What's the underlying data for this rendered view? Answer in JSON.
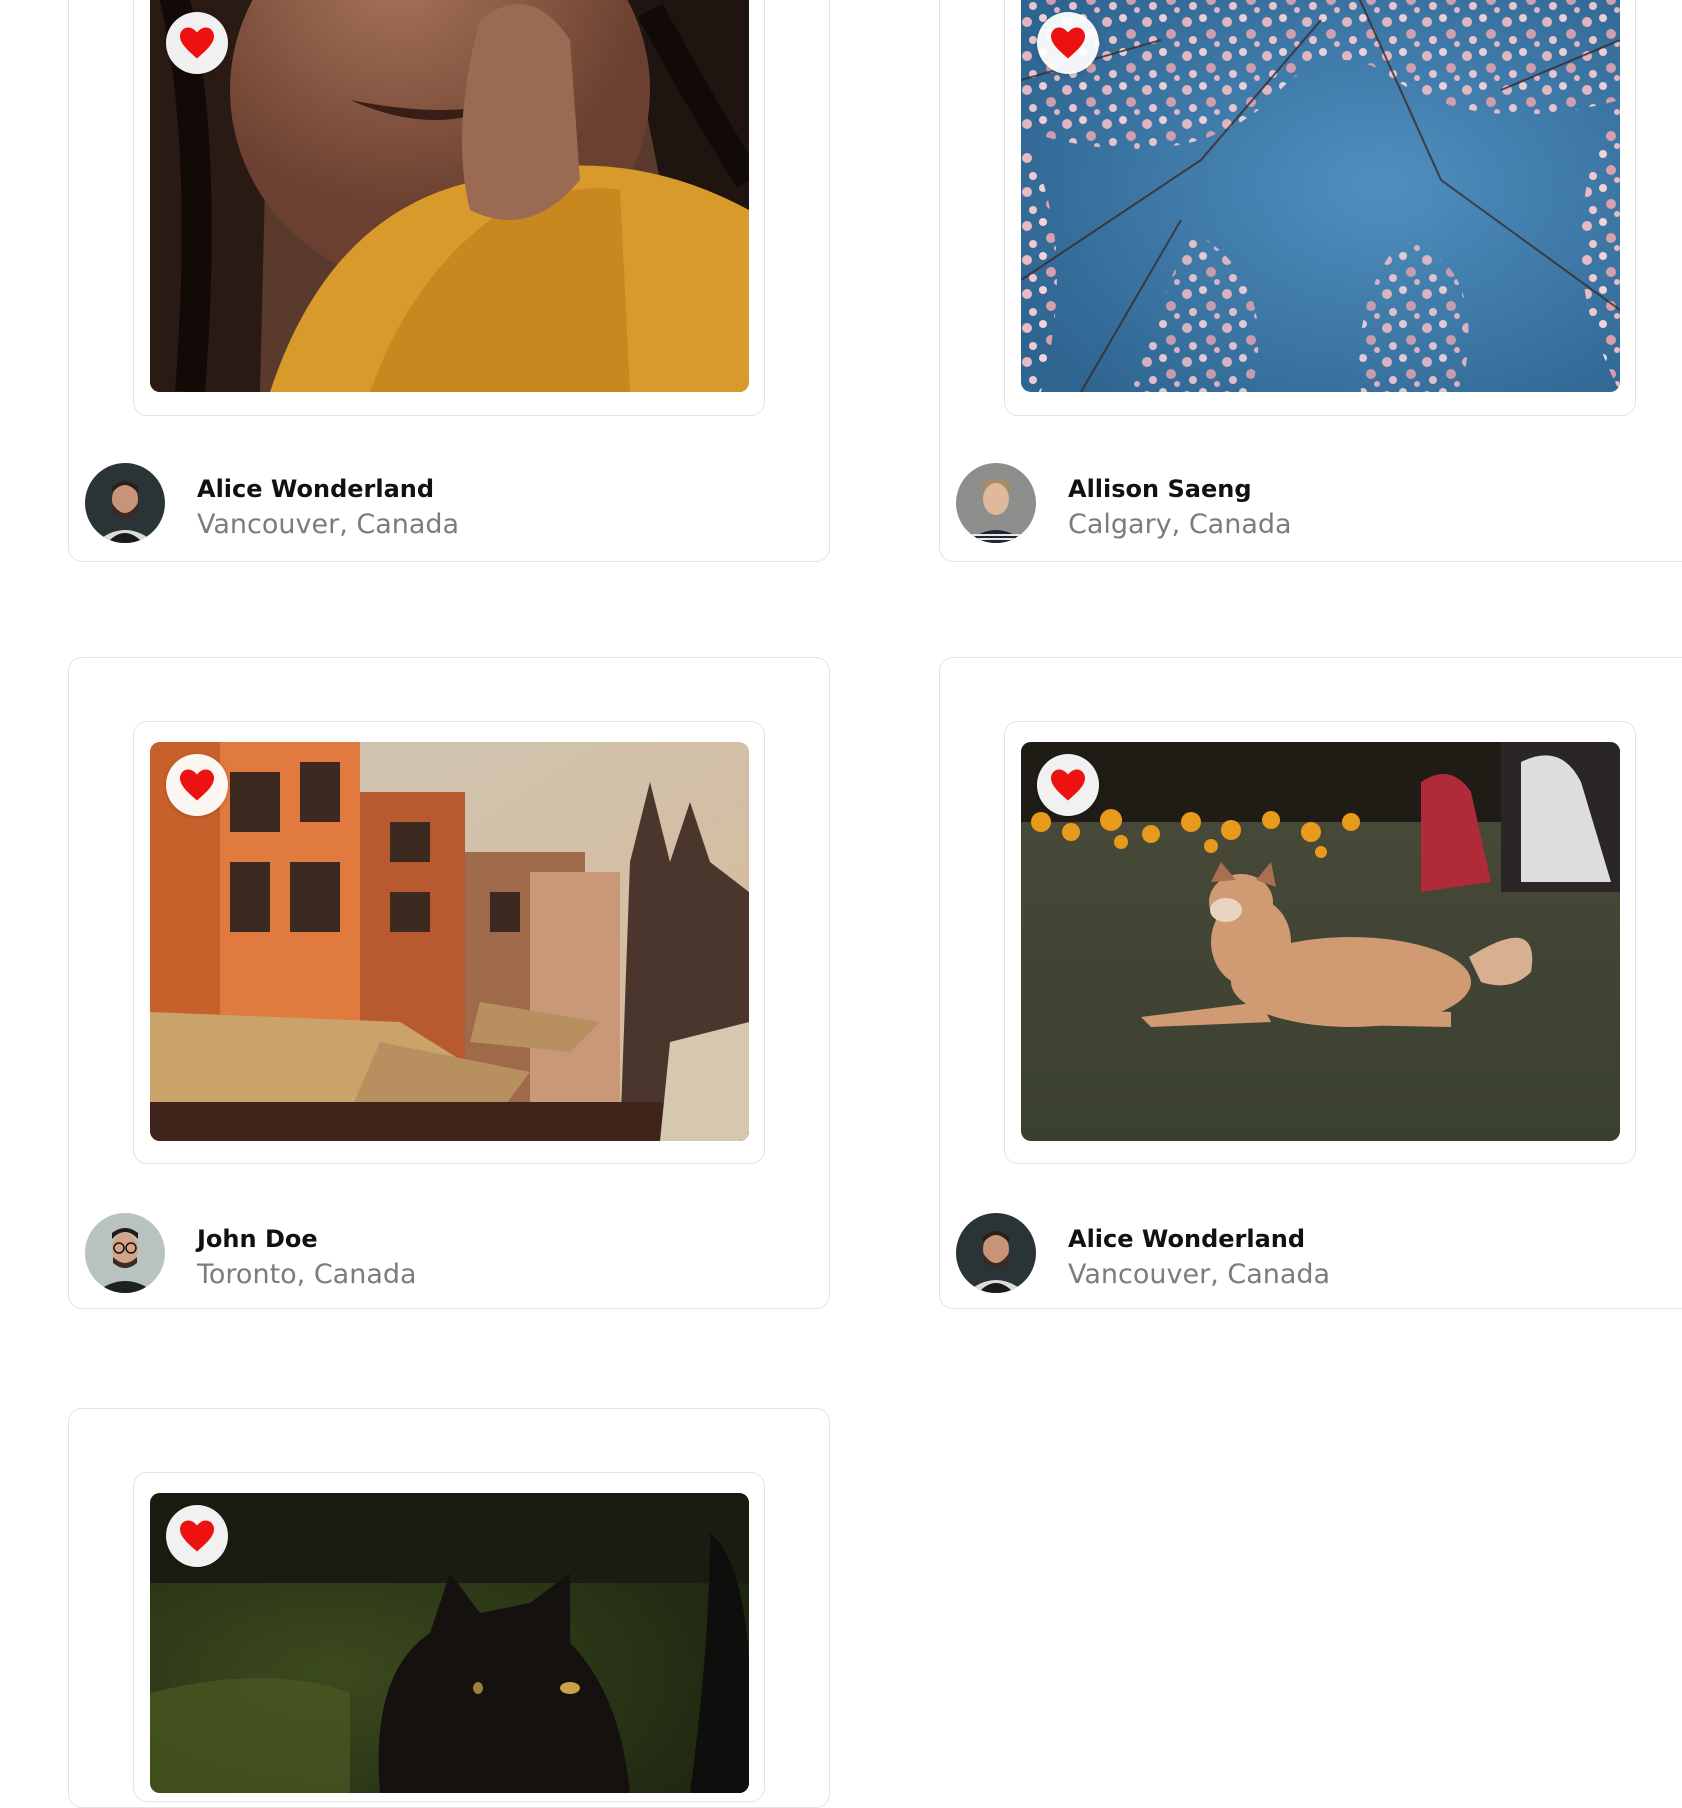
{
  "cards": [
    {
      "author": "Alice Wonderland",
      "location": "Vancouver, Canada",
      "photo": "woman-yellow-sweater-photo",
      "avatar": "bearded-man-avatar"
    },
    {
      "author": "Allison Saeng",
      "location": "Calgary, Canada",
      "photo": "cherry-blossom-photo",
      "avatar": "blond-man-avatar"
    },
    {
      "author": "John Doe",
      "location": "Toronto, Canada",
      "photo": "orange-buildings-temple-photo",
      "avatar": "man-glasses-avatar"
    },
    {
      "author": "Alice Wonderland",
      "location": "Vancouver, Canada",
      "photo": "dog-on-grass-photo",
      "avatar": "bearded-man-avatar"
    },
    {
      "author": "",
      "location": "",
      "photo": "black-cat-photo",
      "avatar": ""
    }
  ],
  "icons": {
    "favorite": "heart-icon"
  },
  "colors": {
    "heart": "#ee1111",
    "card_border": "#e3e3e3",
    "location_text": "#7c7c7c"
  }
}
